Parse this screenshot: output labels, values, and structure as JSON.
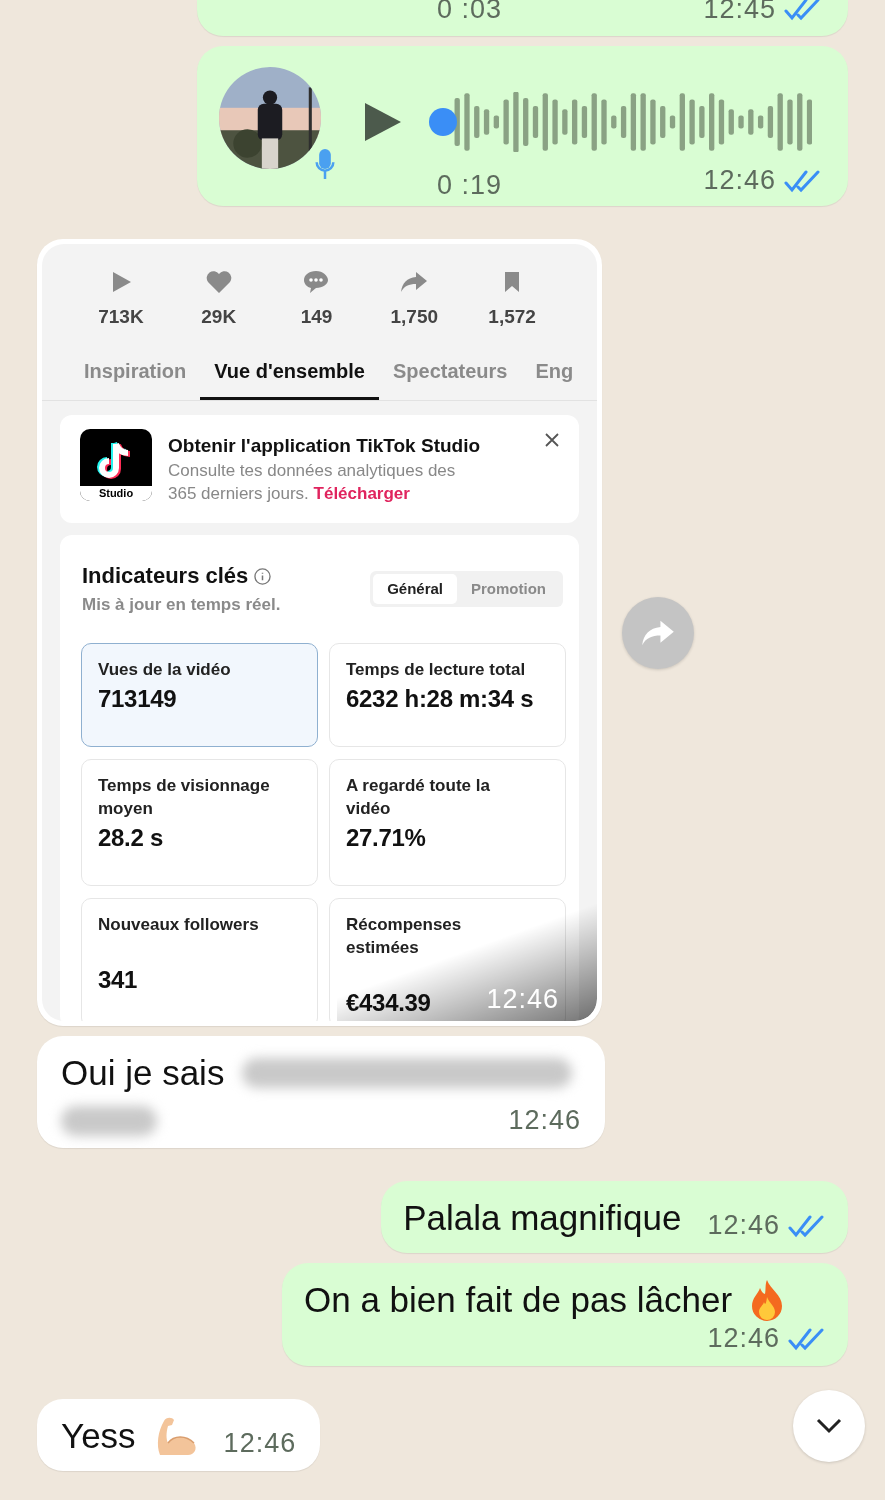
{
  "messages": [
    {
      "kind": "voice",
      "outgoing": true,
      "cropped": true,
      "duration": "0 :03",
      "time": "12:45",
      "read": true
    },
    {
      "kind": "voice",
      "outgoing": true,
      "cropped": false,
      "duration": "0 :19",
      "time": "12:46",
      "read": true
    },
    {
      "outgoing": false,
      "time": "12:46",
      "screenshot": {
        "stats": [
          {
            "kind": "views",
            "value": "713K"
          },
          {
            "kind": "likes",
            "value": "29K"
          },
          {
            "kind": "comments",
            "value": "149"
          },
          {
            "kind": "shares",
            "value": "1,750"
          },
          {
            "kind": "saves",
            "value": "1,572"
          }
        ],
        "tabs": [
          {
            "label": "Inspiration",
            "selected": false
          },
          {
            "label": "Vue d'ensemble",
            "selected": true
          },
          {
            "label": "Spectateurs",
            "selected": false
          },
          {
            "label": "Eng",
            "selected": false
          }
        ],
        "banner": {
          "app_label": "Studio",
          "title": "Obtenir l'application TikTok Studio",
          "text": "Consulte tes données analytiques des 365 derniers jours.",
          "link": "Télécharger"
        },
        "metrics": {
          "title": "Indicateurs clés",
          "subtitle": "Mis à jour en temps réel.",
          "toggle": [
            {
              "label": "Général",
              "selected": true
            },
            {
              "label": "Promotion",
              "selected": false
            }
          ],
          "cards": [
            {
              "label": "Vues de la vidéo",
              "value": "713149",
              "selected": true
            },
            {
              "label": "Temps de lecture total",
              "value": "6232 h:28 m:34 s",
              "selected": false
            },
            {
              "label": "Temps de visionnage moyen",
              "value": "28.2 s",
              "selected": false
            },
            {
              "label": "A regardé toute la vidéo",
              "value": "27.71%",
              "selected": false
            },
            {
              "label": "Nouveaux followers",
              "value": "341",
              "selected": false
            },
            {
              "label": "Récompenses estimées",
              "value": "€434.39",
              "selected": false
            }
          ]
        }
      }
    },
    {
      "kind": "text",
      "outgoing": false,
      "text": "Oui je sais",
      "blurred": true,
      "time": "12:46"
    },
    {
      "kind": "text",
      "outgoing": true,
      "text": "Palala magnifique",
      "time": "12:46",
      "read": true
    },
    {
      "kind": "text",
      "outgoing": true,
      "text": "On a bien fait de pas lâcher",
      "emoji": {
        "kind": "fire"
      },
      "time": "12:46",
      "read": true
    },
    {
      "kind": "text",
      "outgoing": false,
      "text": "Yess",
      "emoji": {
        "kind": "arm"
      },
      "time": "12:46"
    }
  ]
}
